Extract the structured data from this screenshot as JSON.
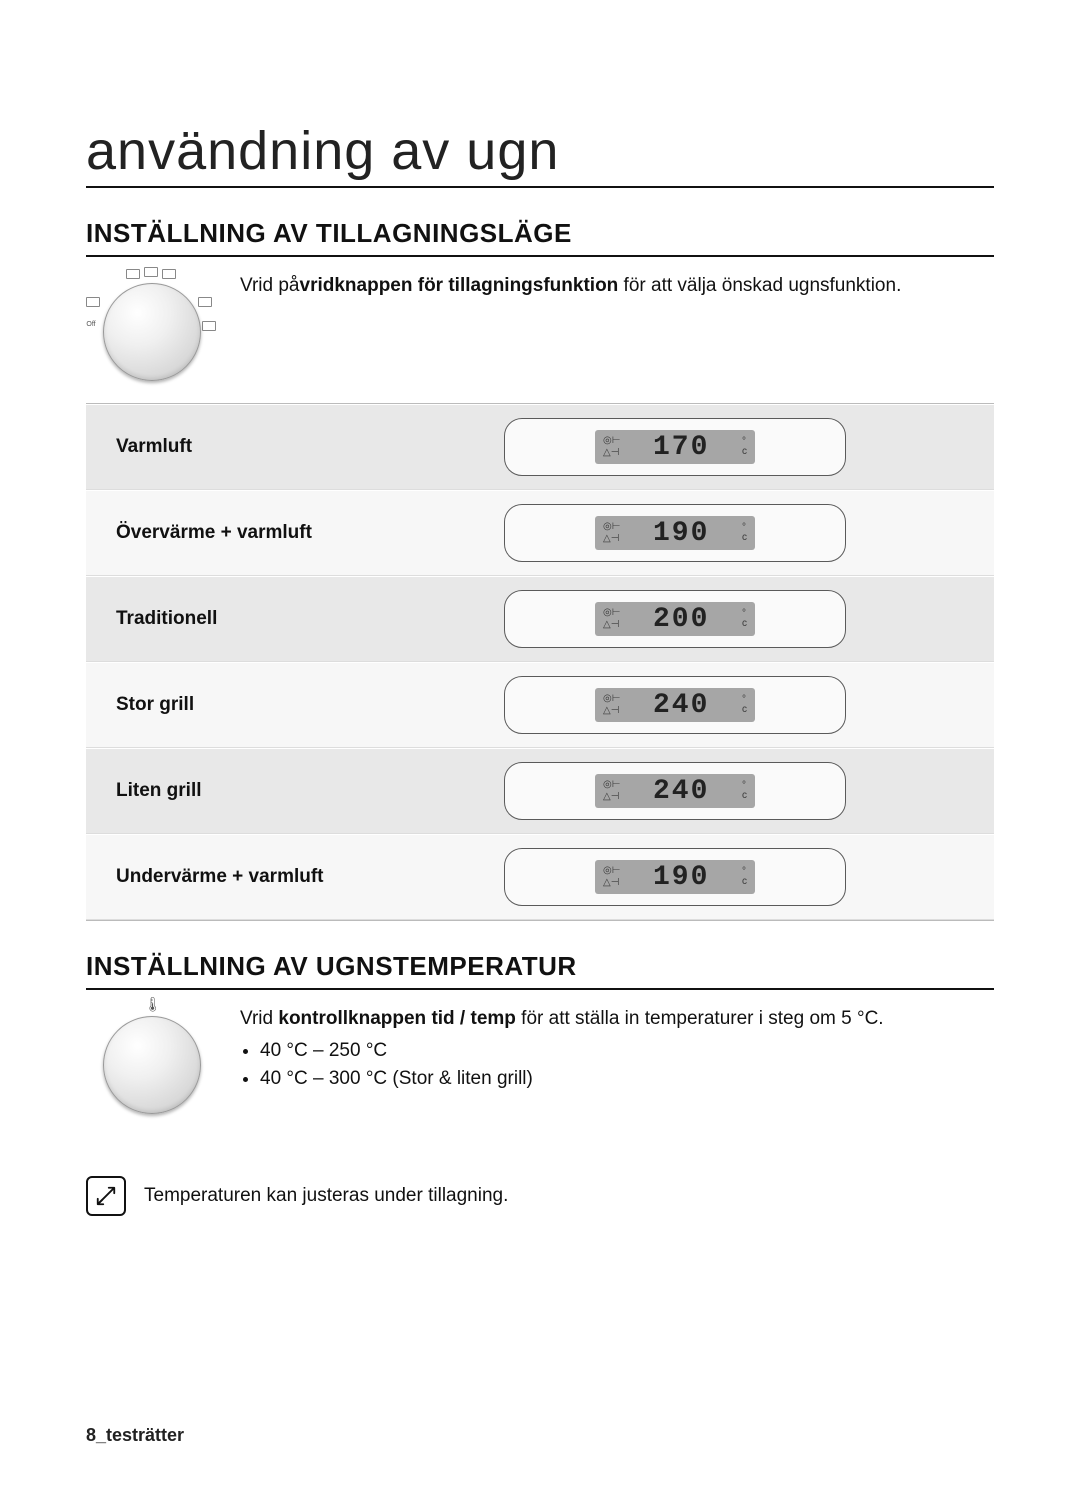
{
  "page": {
    "title": "användning av ugn",
    "footer": "8_testrätter"
  },
  "cooking_mode": {
    "heading": "INSTÄLLNING AV TILLAGNINGSLÄGE",
    "instruction_pre": "Vrid på",
    "instruction_bold": "vridknappen för tillagningsfunktion",
    "instruction_post": " för att välja önskad ugnsfunktion.",
    "rows": [
      {
        "label": "Varmluft",
        "value": "170",
        "alt": true
      },
      {
        "label": "Övervärme + varmluft",
        "value": "190",
        "alt": false
      },
      {
        "label": "Traditionell",
        "value": "200",
        "alt": true
      },
      {
        "label": "Stor grill",
        "value": "240",
        "alt": false
      },
      {
        "label": "Liten grill",
        "value": "240",
        "alt": true
      },
      {
        "label": "Undervärme + varmluft",
        "value": "190",
        "alt": false
      }
    ],
    "unit_top": "°",
    "unit_bot": "c"
  },
  "temperature": {
    "heading": "INSTÄLLNING AV UGNSTEMPERATUR",
    "instruction_pre": "Vrid ",
    "instruction_bold": "kontrollknappen tid / temp",
    "instruction_post": " för att ställa in temperaturer i steg om 5 °C.",
    "ranges": [
      "40 °C – 250 °C",
      "40 °C – 300 °C (Stor & liten grill)"
    ],
    "note": "Temperaturen kan justeras under tillagning."
  }
}
